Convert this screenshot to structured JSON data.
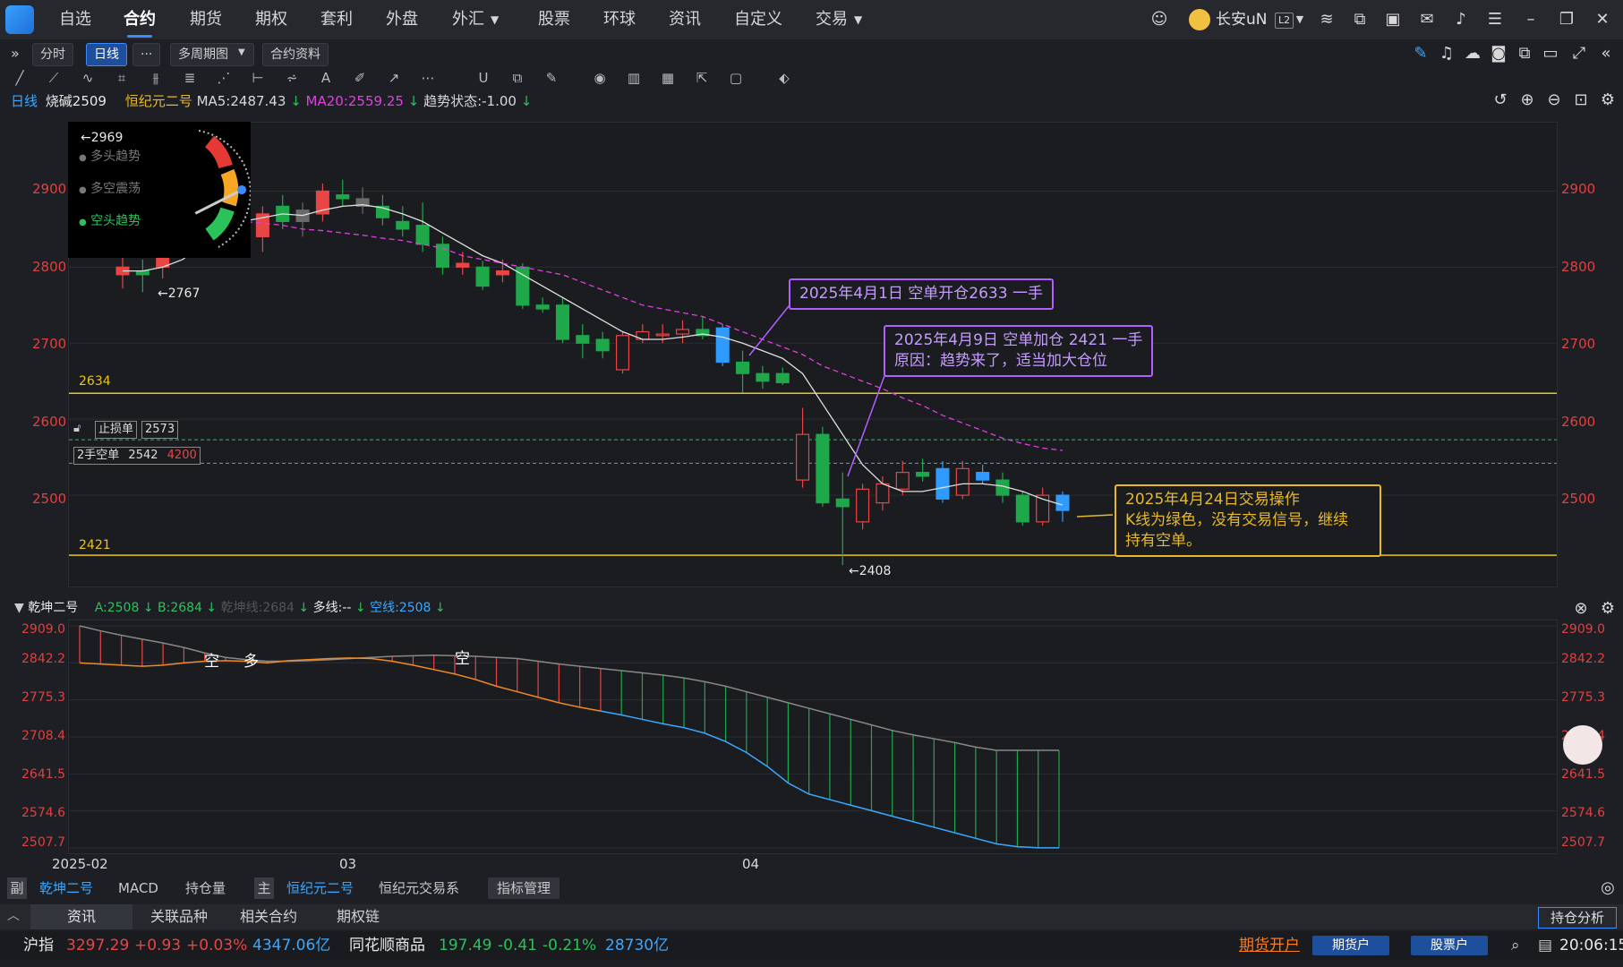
{
  "topnav": {
    "items": [
      "自选",
      "合约",
      "期货",
      "期权",
      "套利",
      "外盘",
      "外汇",
      "股票",
      "环球",
      "资讯",
      "自定义",
      "交易"
    ],
    "active": "合约",
    "user": "长安uN",
    "badge": "L2"
  },
  "toolbar": {
    "periods": [
      "分时",
      "日线",
      "···",
      "多周期图",
      "合约资料"
    ],
    "selected_period": "日线"
  },
  "infoline": {
    "period": "日线",
    "contract": "烧碱2509",
    "indicator": "恒纪元二号",
    "ma5": "MA5:2487.43",
    "ma20": "MA20:2559.25",
    "trend": "趋势状态:-1.00"
  },
  "trend_panel": {
    "value": "←2969",
    "states": [
      "多头趋势",
      "多空震荡",
      "空头趋势"
    ],
    "active": "空头趋势"
  },
  "main_chart": {
    "y_ticks": [
      "2900",
      "2800",
      "2700",
      "2600",
      "2500"
    ],
    "hlines": {
      "upper": "2634",
      "lower": "2421"
    },
    "low_marker": "←2767",
    "low_marker2": "←2408",
    "stop_order": "止损单",
    "stop_value": "2573",
    "position": "2手空单",
    "position_price": "2542",
    "position_pnl": "4200"
  },
  "annotations": [
    {
      "text": "2025年4月1日 空单开仓2633 一手",
      "color": "#b25fff"
    },
    {
      "line1": "2025年4月9日  空单加仓 2421 一手",
      "line2": "原因：趋势来了，适当加大仓位",
      "color": "#b25fff"
    },
    {
      "line1": "2025年4月24日交易操作",
      "line2": "K线为绿色，没有交易信号，继续",
      "line3": "持有空单。",
      "color": "#e7b928"
    }
  ],
  "sub_chart": {
    "title": "乾坤二号",
    "a": "A:2508",
    "b": "B:2684",
    "qk": "乾坤线:2684",
    "dx": "多线:--",
    "kx": "空线:2508",
    "y_ticks": [
      "2909.0",
      "2842.2",
      "2775.3",
      "2708.4",
      "2641.5",
      "2574.6",
      "2507.7"
    ],
    "labels": [
      "空",
      "多",
      "空"
    ]
  },
  "x_axis": [
    "2025-02",
    "03",
    "04"
  ],
  "indicator_tabs": {
    "prefix": "副",
    "items": [
      "乾坤二号",
      "MACD",
      "持仓量"
    ],
    "main_prefix": "主",
    "main_items": [
      "恒纪元二号",
      "恒纪元交易系"
    ],
    "manage": "指标管理"
  },
  "info_tabs": [
    "资讯",
    "关联品种",
    "相关合约",
    "期权链"
  ],
  "hold_analysis": "持仓分析",
  "ticker": {
    "idx_name": "沪指",
    "idx_price": "3297.29",
    "idx_chg": "+0.93",
    "idx_pct": "+0.03%",
    "idx_amt": "4347.06亿",
    "c_name": "同花顺商品",
    "c_price": "197.49",
    "c_chg": "-0.41",
    "c_pct": "-0.21%",
    "c_amt": "28730亿",
    "open_account": "期货开户",
    "futures_btn": "期货户",
    "stock_btn": "股票户",
    "time": "20:06:15"
  },
  "colors": {
    "accent": "#3a8bff",
    "up": "#e84545",
    "down": "#2bc25a",
    "hline": "#e7c51c"
  },
  "chart_data": {
    "type": "candlestick",
    "title": "",
    "ylim": [
      2380,
      2990
    ],
    "x_labels": [
      "2025-02",
      "03",
      "04"
    ],
    "candles": [
      {
        "o": 2790,
        "h": 2815,
        "l": 2772,
        "c": 2800
      },
      {
        "o": 2795,
        "h": 2810,
        "l": 2767,
        "c": 2790
      },
      {
        "o": 2800,
        "h": 2835,
        "l": 2785,
        "c": 2820
      },
      {
        "o": 2840,
        "h": 2885,
        "l": 2830,
        "c": 2870
      },
      {
        "o": 2870,
        "h": 2900,
        "l": 2850,
        "c": 2880
      },
      {
        "o": 2880,
        "h": 2905,
        "l": 2865,
        "c": 2890
      },
      {
        "o": 2860,
        "h": 2880,
        "l": 2830,
        "c": 2840
      },
      {
        "o": 2840,
        "h": 2880,
        "l": 2820,
        "c": 2870
      },
      {
        "o": 2880,
        "h": 2895,
        "l": 2850,
        "c": 2860
      },
      {
        "o": 2860,
        "h": 2885,
        "l": 2840,
        "c": 2875
      },
      {
        "o": 2870,
        "h": 2910,
        "l": 2860,
        "c": 2900
      },
      {
        "o": 2895,
        "h": 2915,
        "l": 2880,
        "c": 2890
      },
      {
        "o": 2890,
        "h": 2905,
        "l": 2870,
        "c": 2880
      },
      {
        "o": 2880,
        "h": 2895,
        "l": 2855,
        "c": 2865
      },
      {
        "o": 2860,
        "h": 2880,
        "l": 2840,
        "c": 2850
      },
      {
        "o": 2855,
        "h": 2885,
        "l": 2820,
        "c": 2830
      },
      {
        "o": 2830,
        "h": 2840,
        "l": 2790,
        "c": 2800
      },
      {
        "o": 2800,
        "h": 2820,
        "l": 2790,
        "c": 2805
      },
      {
        "o": 2800,
        "h": 2808,
        "l": 2770,
        "c": 2775
      },
      {
        "o": 2790,
        "h": 2810,
        "l": 2780,
        "c": 2795
      },
      {
        "o": 2800,
        "h": 2805,
        "l": 2745,
        "c": 2750
      },
      {
        "o": 2750,
        "h": 2760,
        "l": 2740,
        "c": 2745
      },
      {
        "o": 2750,
        "h": 2760,
        "l": 2700,
        "c": 2705
      },
      {
        "o": 2710,
        "h": 2725,
        "l": 2680,
        "c": 2700
      },
      {
        "o": 2705,
        "h": 2715,
        "l": 2680,
        "c": 2690
      },
      {
        "o": 2665,
        "h": 2715,
        "l": 2660,
        "c": 2710
      },
      {
        "o": 2705,
        "h": 2725,
        "l": 2700,
        "c": 2715
      },
      {
        "o": 2710,
        "h": 2725,
        "l": 2700,
        "c": 2712
      },
      {
        "o": 2712,
        "h": 2730,
        "l": 2700,
        "c": 2718
      },
      {
        "o": 2718,
        "h": 2735,
        "l": 2705,
        "c": 2710
      },
      {
        "o": 2720,
        "h": 2725,
        "l": 2670,
        "c": 2675
      },
      {
        "o": 2675,
        "h": 2690,
        "l": 2635,
        "c": 2660
      },
      {
        "o": 2660,
        "h": 2670,
        "l": 2640,
        "c": 2650
      },
      {
        "o": 2660,
        "h": 2668,
        "l": 2645,
        "c": 2648
      },
      {
        "o": 2520,
        "h": 2615,
        "l": 2510,
        "c": 2580
      },
      {
        "o": 2580,
        "h": 2590,
        "l": 2485,
        "c": 2490
      },
      {
        "o": 2495,
        "h": 2530,
        "l": 2408,
        "c": 2485
      },
      {
        "o": 2465,
        "h": 2515,
        "l": 2455,
        "c": 2508
      },
      {
        "o": 2490,
        "h": 2525,
        "l": 2480,
        "c": 2515
      },
      {
        "o": 2508,
        "h": 2545,
        "l": 2500,
        "c": 2530
      },
      {
        "o": 2530,
        "h": 2548,
        "l": 2518,
        "c": 2525
      },
      {
        "o": 2535,
        "h": 2545,
        "l": 2490,
        "c": 2495
      },
      {
        "o": 2500,
        "h": 2545,
        "l": 2495,
        "c": 2535
      },
      {
        "o": 2530,
        "h": 2540,
        "l": 2515,
        "c": 2520
      },
      {
        "o": 2520,
        "h": 2530,
        "l": 2490,
        "c": 2500
      },
      {
        "o": 2500,
        "h": 2505,
        "l": 2460,
        "c": 2465
      },
      {
        "o": 2465,
        "h": 2510,
        "l": 2460,
        "c": 2500
      },
      {
        "o": 2500,
        "h": 2505,
        "l": 2465,
        "c": 2480
      }
    ],
    "ma5": [
      2795,
      2795,
      2800,
      2810,
      2830,
      2845,
      2860,
      2865,
      2870,
      2868,
      2875,
      2880,
      2882,
      2878,
      2870,
      2860,
      2845,
      2830,
      2815,
      2805,
      2790,
      2775,
      2760,
      2745,
      2730,
      2715,
      2705,
      2705,
      2708,
      2712,
      2708,
      2700,
      2690,
      2680,
      2660,
      2620,
      2580,
      2540,
      2515,
      2505,
      2505,
      2510,
      2515,
      2515,
      2512,
      2505,
      2495,
      2487
    ],
    "ma20": [
      2880,
      2878,
      2875,
      2872,
      2870,
      2865,
      2860,
      2858,
      2855,
      2850,
      2848,
      2845,
      2842,
      2838,
      2835,
      2830,
      2825,
      2815,
      2810,
      2805,
      2800,
      2795,
      2790,
      2780,
      2770,
      2760,
      2750,
      2745,
      2740,
      2735,
      2725,
      2715,
      2705,
      2695,
      2685,
      2670,
      2660,
      2650,
      2640,
      2628,
      2618,
      2605,
      2595,
      2585,
      2575,
      2568,
      2562,
      2559
    ],
    "sub_upper": [
      2909,
      2900,
      2892,
      2885,
      2878,
      2870,
      2860,
      2852,
      2848,
      2845,
      2845,
      2846,
      2848,
      2850,
      2852,
      2854,
      2855,
      2856,
      2855,
      2854,
      2852,
      2850,
      2845,
      2840,
      2836,
      2832,
      2828,
      2824,
      2820,
      2815,
      2808,
      2800,
      2790,
      2780,
      2770,
      2760,
      2750,
      2740,
      2730,
      2720,
      2712,
      2705,
      2698,
      2690,
      2684,
      2684,
      2684,
      2684
    ],
    "sub_lower": [
      2842,
      2840,
      2838,
      2836,
      2838,
      2842,
      2845,
      2846,
      2845,
      2842,
      2846,
      2848,
      2850,
      2851,
      2850,
      2845,
      2838,
      2830,
      2822,
      2812,
      2800,
      2790,
      2780,
      2770,
      2762,
      2755,
      2748,
      2740,
      2732,
      2725,
      2715,
      2700,
      2680,
      2655,
      2625,
      2605,
      2595,
      2585,
      2575,
      2565,
      2555,
      2545,
      2535,
      2525,
      2515,
      2510,
      2508,
      2508
    ]
  }
}
